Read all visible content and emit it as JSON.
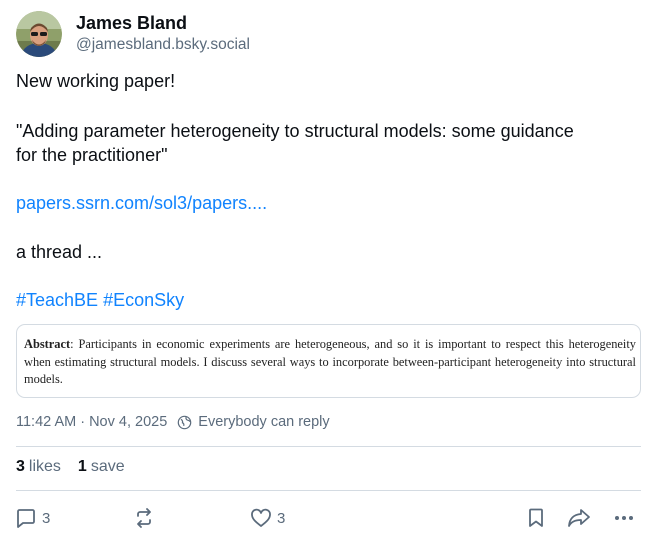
{
  "author": {
    "display_name": "James Bland",
    "handle": "@jamesbland.bsky.social"
  },
  "post": {
    "line1": "New working paper!",
    "line2": "\"Adding parameter heterogeneity to structural models: some guidance",
    "line3": "for the practitioner\"",
    "link": "papers.ssrn.com/sol3/papers....",
    "line4": "a thread ...",
    "hashtags": [
      "#TeachBE",
      "#EconSky"
    ]
  },
  "embed": {
    "label": "Abstract",
    "text": ": Participants in economic experiments are heterogeneous, and so it is important to respect this heterogeneity when estimating structural models. I discuss several ways to incorporate between-participant heterogeneity into structural models."
  },
  "meta": {
    "timestamp": "11:42 AM · Nov 4, 2025",
    "reply_setting": "Everybody can reply"
  },
  "stats": {
    "likes_count": "3",
    "likes_label": "likes",
    "saves_count": "1",
    "saves_label": "save"
  },
  "actions": {
    "reply_count": "3",
    "like_count": "3"
  },
  "icons": [
    "reply-icon",
    "repost-icon",
    "heart-icon",
    "bookmark-icon",
    "share-icon",
    "more-icon",
    "globe-icon"
  ],
  "colors": {
    "link": "#1083fe",
    "muted": "#5b6b7c",
    "border": "#d4dbe2",
    "text": "#0b0f14"
  }
}
